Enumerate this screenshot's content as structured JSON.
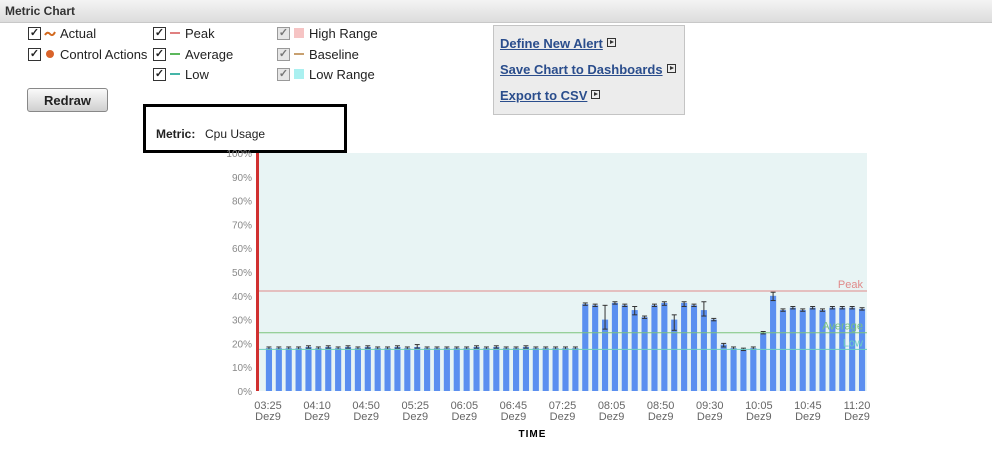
{
  "window": {
    "title": "Metric Chart"
  },
  "legend": {
    "col1": [
      {
        "label": "Actual",
        "icon": "tilde-icon",
        "color": "#d2691e",
        "checked": true
      },
      {
        "label": "Control Actions",
        "icon": "dot-icon",
        "color": "#d9632a",
        "checked": true
      }
    ],
    "col2": [
      {
        "label": "Peak",
        "icon": "line-icon",
        "color": "#e08080",
        "checked": true
      },
      {
        "label": "Average",
        "icon": "line-icon",
        "color": "#5cb85c",
        "checked": true
      },
      {
        "label": "Low",
        "icon": "line-icon",
        "color": "#45b5a8",
        "checked": true
      }
    ],
    "col3": [
      {
        "label": "High Range",
        "icon": "square-icon",
        "color": "#f6c4c4",
        "checked": true
      },
      {
        "label": "Baseline",
        "icon": "line-icon",
        "color": "#c8a070",
        "checked": true
      },
      {
        "label": "Low Range",
        "icon": "square-icon",
        "color": "#aaf0f0",
        "checked": true
      }
    ]
  },
  "redraw_label": "Redraw",
  "metric": {
    "key": "Metric:",
    "value": "Cpu Usage"
  },
  "actions": [
    {
      "label": "Define New Alert"
    },
    {
      "label": "Save Chart to Dashboards"
    },
    {
      "label": "Export to CSV"
    }
  ],
  "chart_data": {
    "type": "bar",
    "xlabel": "TIME",
    "ylim": [
      0,
      100
    ],
    "yticks": [
      "0%",
      "10%",
      "20%",
      "30%",
      "40%",
      "50%",
      "60%",
      "70%",
      "80%",
      "90%",
      "100%"
    ],
    "xticks": [
      {
        "time": "03:25",
        "date": "Dez9"
      },
      {
        "time": "04:10",
        "date": "Dez9"
      },
      {
        "time": "04:50",
        "date": "Dez9"
      },
      {
        "time": "05:25",
        "date": "Dez9"
      },
      {
        "time": "06:05",
        "date": "Dez9"
      },
      {
        "time": "06:45",
        "date": "Dez9"
      },
      {
        "time": "07:25",
        "date": "Dez9"
      },
      {
        "time": "08:05",
        "date": "Dez9"
      },
      {
        "time": "08:50",
        "date": "Dez9"
      },
      {
        "time": "09:30",
        "date": "Dez9"
      },
      {
        "time": "10:05",
        "date": "Dez9"
      },
      {
        "time": "10:45",
        "date": "Dez9"
      },
      {
        "time": "11:20",
        "date": "Dez9"
      }
    ],
    "values": [
      18,
      18,
      18,
      18,
      18.5,
      18,
      18.5,
      18,
      18.5,
      18,
      18.5,
      18,
      18,
      18.5,
      18,
      18.5,
      18,
      18,
      18,
      18,
      18,
      18.5,
      18,
      18.5,
      18,
      18,
      18.5,
      18,
      18,
      18,
      18,
      18,
      36.5,
      36,
      30,
      37,
      36,
      34,
      31,
      36,
      37,
      30,
      37,
      36,
      34,
      30,
      19.5,
      18,
      17.5,
      18,
      24.5,
      40,
      34,
      35,
      34,
      35,
      34,
      35,
      35,
      35,
      34.5
    ],
    "range_lows": [
      17.5,
      17.5,
      17.5,
      17.5,
      18,
      17.5,
      18,
      17.5,
      18,
      17.5,
      18,
      17.5,
      17.5,
      18,
      17.5,
      18,
      17.5,
      17.5,
      17.5,
      17.5,
      17.5,
      18,
      17.5,
      18,
      17.5,
      17.5,
      18,
      17.5,
      17.5,
      17.5,
      17.5,
      17.5,
      36,
      35.5,
      26,
      36.5,
      35.5,
      32,
      30.5,
      35.5,
      36,
      25.5,
      35.5,
      35.5,
      31.5,
      29.5,
      18.5,
      17.5,
      17,
      17.5,
      24,
      38,
      33.5,
      34.5,
      33.5,
      34.5,
      33.5,
      34.5,
      34.5,
      34.5,
      34
    ],
    "range_highs": [
      18.5,
      18.5,
      18.5,
      18.5,
      19,
      18.5,
      19,
      18.5,
      19,
      18.5,
      19,
      18.5,
      18.5,
      19,
      18.5,
      19.5,
      18.5,
      18.5,
      18.5,
      18.5,
      18.5,
      19,
      18.5,
      19,
      18.5,
      18.5,
      19,
      18.5,
      18.5,
      18.5,
      18.5,
      18.5,
      37,
      36.5,
      36,
      37.5,
      36.5,
      35.5,
      31.5,
      36.5,
      37.5,
      32,
      37.5,
      36.5,
      37.5,
      30.5,
      20,
      18.5,
      18,
      18.5,
      25,
      41.5,
      34.5,
      35.5,
      34.5,
      35.5,
      34.5,
      35.5,
      35.5,
      35.5,
      35
    ],
    "reference_lines": [
      {
        "name": "Peak",
        "value": 42,
        "color": "#e08a8a"
      },
      {
        "name": "Average",
        "value": 24.5,
        "color": "#7cc47c"
      },
      {
        "name": "Low",
        "value": 17.5,
        "color": "#6ccdc0"
      }
    ],
    "colors": {
      "bar": "#5b8ff0",
      "plot_bg": "#e8f4f4",
      "marker": "#d03030"
    }
  }
}
